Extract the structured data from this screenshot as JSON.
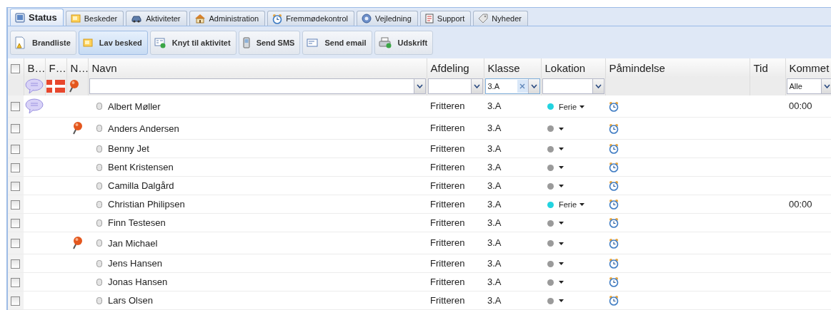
{
  "tabs": [
    {
      "label": "Status",
      "selected": true
    },
    {
      "label": "Beskeder",
      "selected": false
    },
    {
      "label": "Aktiviteter",
      "selected": false
    },
    {
      "label": "Administration",
      "selected": false
    },
    {
      "label": "Fremmødekontrol",
      "selected": false
    },
    {
      "label": "Vejledning",
      "selected": false
    },
    {
      "label": "Support",
      "selected": false
    },
    {
      "label": "Nyheder",
      "selected": false
    }
  ],
  "toolbar": [
    {
      "label": "Brandliste",
      "selected": false
    },
    {
      "label": "Lav besked",
      "selected": true
    },
    {
      "label": "Knyt til aktivitet",
      "selected": false
    },
    {
      "label": "Send SMS",
      "selected": false
    },
    {
      "label": "Send email",
      "selected": false
    },
    {
      "label": "Udskrift",
      "selected": false
    }
  ],
  "table": {
    "select_all": {
      "checked": false
    },
    "columns": [
      "B…",
      "F…",
      "N…",
      "Navn",
      "Afdeling",
      "Klasse",
      "Lokation",
      "Påmindelse",
      "Tid",
      "Kommet"
    ],
    "filters": {
      "klasse": {
        "value": "3.A"
      },
      "kommet": {
        "value": "Alle"
      }
    },
    "rows": [
      {
        "checked": false,
        "message": true,
        "note": false,
        "name": "Albert Møller",
        "afdeling": "Fritteren",
        "klasse": "3.A",
        "lokation": {
          "color": "#22d3e0",
          "label": "Ferie"
        },
        "kommet": "00:00"
      },
      {
        "checked": false,
        "message": false,
        "note": true,
        "name": "Anders Andersen",
        "afdeling": "Fritteren",
        "klasse": "3.A",
        "lokation": {
          "color": "#9a9a9a"
        }
      },
      {
        "checked": false,
        "message": false,
        "note": false,
        "name": "Benny Jet",
        "afdeling": "Fritteren",
        "klasse": "3.A",
        "lokation": {
          "color": "#9a9a9a"
        }
      },
      {
        "checked": false,
        "message": false,
        "note": false,
        "name": "Bent Kristensen",
        "afdeling": "Fritteren",
        "klasse": "3.A",
        "lokation": {
          "color": "#9a9a9a"
        }
      },
      {
        "checked": false,
        "message": false,
        "note": false,
        "name": "Camilla Dalgård",
        "afdeling": "Fritteren",
        "klasse": "3.A",
        "lokation": {
          "color": "#9a9a9a"
        }
      },
      {
        "checked": false,
        "message": false,
        "note": false,
        "name": "Christian Philipsen",
        "afdeling": "Fritteren",
        "klasse": "3.A",
        "lokation": {
          "color": "#22d3e0",
          "label": "Ferie"
        },
        "kommet": "00:00"
      },
      {
        "checked": false,
        "message": false,
        "note": false,
        "name": "Finn Testesen",
        "afdeling": "Fritteren",
        "klasse": "3.A",
        "lokation": {
          "color": "#9a9a9a"
        }
      },
      {
        "checked": false,
        "message": false,
        "note": true,
        "name": "Jan Michael",
        "afdeling": "Fritteren",
        "klasse": "3.A",
        "lokation": {
          "color": "#9a9a9a"
        }
      },
      {
        "checked": false,
        "message": false,
        "note": false,
        "name": "Jens Hansen",
        "afdeling": "Fritteren",
        "klasse": "3.A",
        "lokation": {
          "color": "#9a9a9a"
        }
      },
      {
        "checked": false,
        "message": false,
        "note": false,
        "name": "Jonas Hansen",
        "afdeling": "Fritteren",
        "klasse": "3.A",
        "lokation": {
          "color": "#9a9a9a"
        }
      },
      {
        "checked": false,
        "message": false,
        "note": false,
        "name": "Lars Olsen",
        "afdeling": "Fritteren",
        "klasse": "3.A",
        "lokation": {
          "color": "#9a9a9a"
        }
      }
    ]
  }
}
